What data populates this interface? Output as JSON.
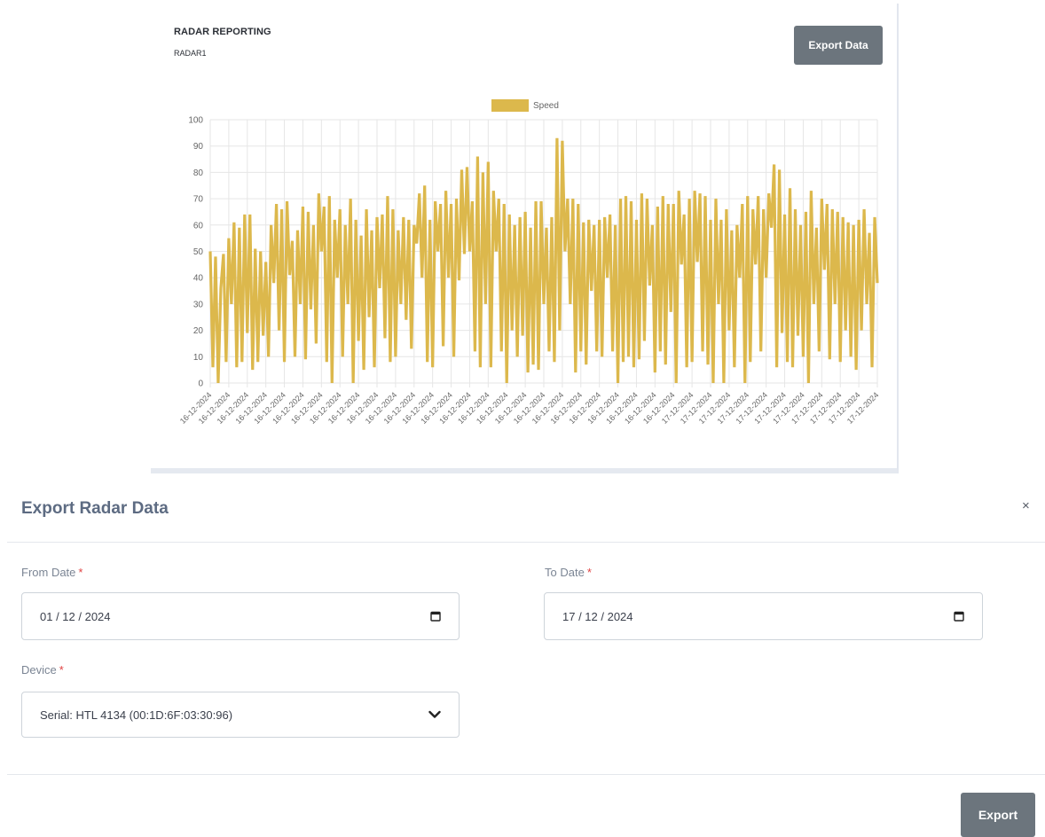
{
  "card": {
    "title": "RADAR REPORTING",
    "subtitle": "RADAR1",
    "export_button": "Export Data"
  },
  "chart_data": {
    "type": "line",
    "legend": "Speed",
    "series_color": "#dcb84c",
    "ylim": [
      0,
      100
    ],
    "yticks": [
      0,
      10,
      20,
      30,
      40,
      50,
      60,
      70,
      80,
      90,
      100
    ],
    "grid": true,
    "legend_position": "top",
    "x_tick_labels": [
      "16-12-2024",
      "16-12-2024",
      "16-12-2024",
      "16-12-2024",
      "16-12-2024",
      "16-12-2024",
      "16-12-2024",
      "16-12-2024",
      "16-12-2024",
      "16-12-2024",
      "16-12-2024",
      "16-12-2024",
      "16-12-2024",
      "16-12-2024",
      "16-12-2024",
      "16-12-2024",
      "16-12-2024",
      "16-12-2024",
      "16-12-2024",
      "16-12-2024",
      "16-12-2024",
      "16-12-2024",
      "16-12-2024",
      "16-12-2024",
      "16-12-2024",
      "16-12-2024",
      "17-12-2024",
      "17-12-2024",
      "17-12-2024",
      "17-12-2024",
      "17-12-2024",
      "17-12-2024",
      "17-12-2024",
      "17-12-2024",
      "17-12-2024",
      "17-12-2024",
      "17-12-2024"
    ],
    "values": [
      50,
      6,
      48,
      0,
      36,
      49,
      8,
      55,
      30,
      61,
      6,
      59,
      8,
      64,
      19,
      64,
      5,
      51,
      8,
      50,
      18,
      46,
      10,
      60,
      38,
      68,
      20,
      66,
      8,
      69,
      41,
      54,
      10,
      58,
      30,
      67,
      9,
      65,
      28,
      60,
      15,
      72,
      50,
      67,
      8,
      71,
      0,
      62,
      40,
      66,
      10,
      60,
      30,
      70,
      0,
      62,
      16,
      56,
      5,
      66,
      25,
      58,
      6,
      63,
      36,
      64,
      17,
      71,
      8,
      66,
      10,
      58,
      30,
      63,
      24,
      62,
      13,
      60,
      53,
      72,
      40,
      75,
      8,
      62,
      6,
      69,
      50,
      68,
      14,
      73,
      40,
      68,
      10,
      70,
      39,
      81,
      49,
      82,
      50,
      69,
      12,
      86,
      6,
      80,
      30,
      84,
      6,
      73,
      50,
      70,
      12,
      68,
      0,
      64,
      20,
      60,
      10,
      63,
      18,
      65,
      4,
      59,
      7,
      69,
      5,
      69,
      30,
      59,
      12,
      63,
      8,
      93,
      20,
      92,
      50,
      70,
      30,
      70,
      4,
      68,
      12,
      61,
      7,
      62,
      35,
      60,
      12,
      62,
      10,
      63,
      40,
      64,
      12,
      60,
      0,
      70,
      8,
      71,
      10,
      69,
      6,
      62,
      9,
      72,
      16,
      70,
      37,
      60,
      4,
      67,
      12,
      71,
      7,
      68,
      27,
      68,
      0,
      73,
      45,
      64,
      6,
      70,
      8,
      73,
      46,
      72,
      12,
      71,
      7,
      62,
      0,
      70,
      30,
      62,
      0,
      66,
      20,
      58,
      6,
      60,
      40,
      68,
      0,
      71,
      8,
      66,
      45,
      71,
      12,
      66,
      40,
      72,
      59,
      83,
      6,
      81,
      19,
      64,
      8,
      74,
      6,
      66,
      18,
      60,
      10,
      65,
      0,
      73,
      30,
      59,
      12,
      70,
      43,
      68,
      9,
      66,
      30,
      65,
      8,
      63,
      20,
      61,
      10,
      60,
      5,
      62,
      20,
      66,
      30,
      57,
      6,
      63,
      38
    ]
  },
  "modal": {
    "title": "Export Radar Data",
    "close": "×",
    "from_label": "From Date",
    "to_label": "To Date",
    "device_label": "Device",
    "required_mark": "*",
    "from_value": "01 / 12 / 2024",
    "to_value": "17 / 12 / 2024",
    "device_value": "Serial: HTL 4134 (00:1D:6F:03:30:96)",
    "export_button": "Export"
  },
  "icons": {
    "calendar": "calendar-icon",
    "chevron": "chevron-down-icon"
  }
}
